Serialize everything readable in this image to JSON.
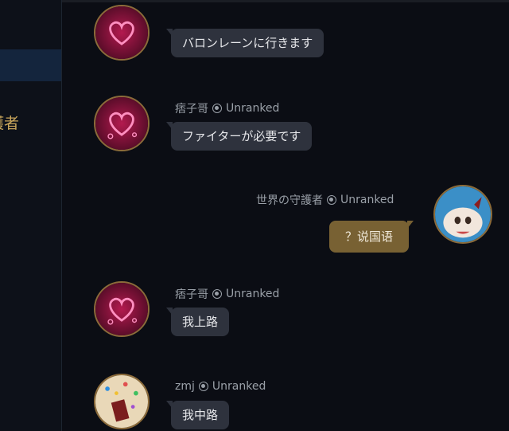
{
  "sidebar": {
    "partial_label": "護者"
  },
  "messages": [
    {
      "author": "",
      "rank": "",
      "text": "バロンレーンに行きます"
    },
    {
      "author": "痞子哥",
      "rank": "Unranked",
      "text": "ファイターが必要です"
    },
    {
      "author": "世界の守護者",
      "rank": "Unranked",
      "text": "？说国语"
    },
    {
      "author": "痞子哥",
      "rank": "Unranked",
      "text": "我上路"
    },
    {
      "author": "zmj",
      "rank": "Unranked",
      "text": "我中路"
    }
  ],
  "colors": {
    "accent_gold": "#c9a65b",
    "my_bubble": "#786133",
    "bubble": "#2e323d"
  }
}
